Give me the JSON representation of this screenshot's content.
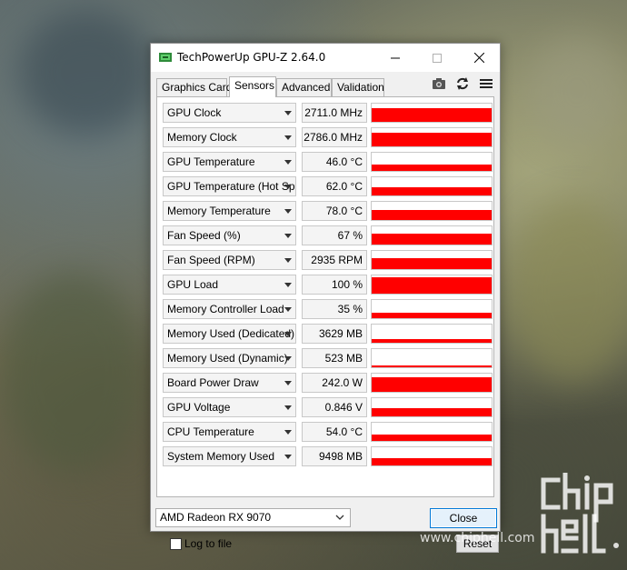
{
  "window": {
    "title": "TechPowerUp GPU-Z 2.64.0",
    "tabs": [
      {
        "label": "Graphics Card",
        "active": false
      },
      {
        "label": "Sensors",
        "active": true
      },
      {
        "label": "Advanced",
        "active": false
      },
      {
        "label": "Validation",
        "active": false
      }
    ],
    "toolbar_icons": [
      "camera-icon",
      "refresh-icon",
      "menu-icon"
    ]
  },
  "sensors": [
    {
      "name": "GPU Clock",
      "value": "2711.0 MHz",
      "level": 0.75
    },
    {
      "name": "Memory Clock",
      "value": "2786.0 MHz",
      "level": 0.75
    },
    {
      "name": "GPU Temperature",
      "value": "46.0 °C",
      "level": 0.35
    },
    {
      "name": "GPU Temperature (Hot Spot)",
      "value": "62.0 °C",
      "level": 0.45
    },
    {
      "name": "Memory Temperature",
      "value": "78.0 °C",
      "level": 0.55
    },
    {
      "name": "Fan Speed (%)",
      "value": "67 %",
      "level": 0.6
    },
    {
      "name": "Fan Speed (RPM)",
      "value": "2935 RPM",
      "level": 0.6
    },
    {
      "name": "GPU Load",
      "value": "100 %",
      "level": 0.9
    },
    {
      "name": "Memory Controller Load",
      "value": "35 %",
      "level": 0.3
    },
    {
      "name": "Memory Used (Dedicated)",
      "value": "3629 MB",
      "level": 0.2
    },
    {
      "name": "Memory Used (Dynamic)",
      "value": "523 MB",
      "level": 0.08
    },
    {
      "name": "Board Power Draw",
      "value": "242.0 W",
      "level": 0.8
    },
    {
      "name": "GPU Voltage",
      "value": "0.846 V",
      "level": 0.45
    },
    {
      "name": "CPU Temperature",
      "value": "54.0 °C",
      "level": 0.35
    },
    {
      "name": "System Memory Used",
      "value": "9498 MB",
      "level": 0.4
    }
  ],
  "footer": {
    "log_label": "Log to file",
    "log_checked": false,
    "reset_label": "Reset",
    "gpu_selected": "AMD Radeon RX 9070",
    "close_label": "Close"
  },
  "watermark": {
    "logo_text": "chip hell",
    "url": "www.chiphell.com"
  },
  "colors": {
    "graph": "#ff0000",
    "accent": "#0078d7"
  }
}
